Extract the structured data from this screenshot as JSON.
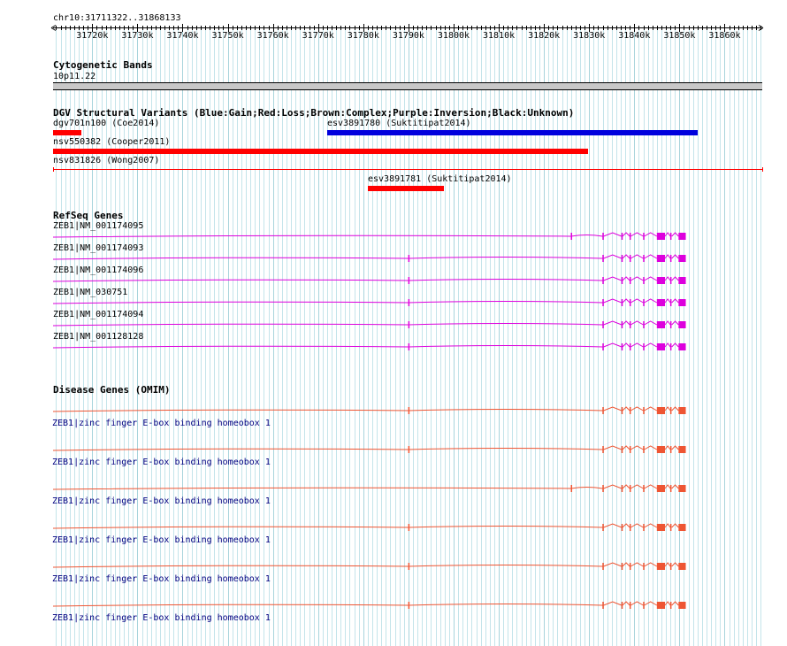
{
  "ruler": {
    "coordinate_label": "chr10:31711322..31868133",
    "start": 31711322,
    "end": 31868133,
    "ticks": [
      "31720k",
      "31730k",
      "31740k",
      "31750k",
      "31760k",
      "31770k",
      "31780k",
      "31790k",
      "31800k",
      "31810k",
      "31820k",
      "31830k",
      "31840k",
      "31850k",
      "31860k"
    ],
    "tick_values": [
      31720000,
      31730000,
      31740000,
      31750000,
      31760000,
      31770000,
      31780000,
      31790000,
      31800000,
      31810000,
      31820000,
      31830000,
      31840000,
      31850000,
      31860000
    ]
  },
  "cytobands": {
    "title": "Cytogenetic Bands",
    "band": "10p11.22"
  },
  "dgv": {
    "title": "DGV Structural Variants (Blue:Gain;Red:Loss;Brown:Complex;Purple:Inversion;Black:Unknown)",
    "variants": [
      {
        "label": "dgv701n100 (Coe2014)",
        "color": "#ff0000",
        "start": 31711322,
        "end": 31717500,
        "style": "bar"
      },
      {
        "label": "esv3891780 (Suktitipat2014)",
        "color": "#0000dd",
        "start": 31772000,
        "end": 31854000,
        "style": "bar"
      },
      {
        "label": "nsv550382 (Cooper2011)",
        "color": "#ff0000",
        "start": 31711322,
        "end": 31829700,
        "style": "bar"
      },
      {
        "label": "nsv831826 (Wong2007)",
        "color": "#ff0000",
        "start": 31711322,
        "end": 31868133,
        "style": "line"
      },
      {
        "label": "esv3891781 (Suktitipat2014)",
        "color": "#ff0000",
        "start": 31781100,
        "end": 31798000,
        "style": "bar"
      }
    ]
  },
  "refseq": {
    "title": "RefSeq Genes",
    "color": "#dd00dd",
    "genes": [
      {
        "label": "ZEB1|NM_001174095",
        "first_exon": 31826000
      },
      {
        "label": "ZEB1|NM_001174093",
        "first_exon": 31790000
      },
      {
        "label": "ZEB1|NM_001174096",
        "first_exon": 31790000
      },
      {
        "label": "ZEB1|NM_030751",
        "first_exon": 31790000
      },
      {
        "label": "ZEB1|NM_001174094",
        "first_exon": 31790000
      },
      {
        "label": "ZEB1|NM_001128128",
        "first_exon": 31790000
      }
    ]
  },
  "omim": {
    "title": "Disease Genes (OMIM)",
    "color": "#ee5533",
    "genes": [
      {
        "label": "ZEB1|zinc finger E-box binding homeobox 1",
        "first_exon": 31790000
      },
      {
        "label": "ZEB1|zinc finger E-box binding homeobox 1",
        "first_exon": 31790000
      },
      {
        "label": "ZEB1|zinc finger E-box binding homeobox 1",
        "first_exon": 31826000
      },
      {
        "label": "ZEB1|zinc finger E-box binding homeobox 1",
        "first_exon": 31790000
      },
      {
        "label": "ZEB1|zinc finger E-box binding homeobox 1",
        "first_exon": 31790000
      },
      {
        "label": "ZEB1|zinc finger E-box binding homeobox 1",
        "first_exon": 31790000
      }
    ]
  },
  "colors": {
    "grid": "#a8d4dc",
    "grid_dotted": "#c4e4ea"
  }
}
